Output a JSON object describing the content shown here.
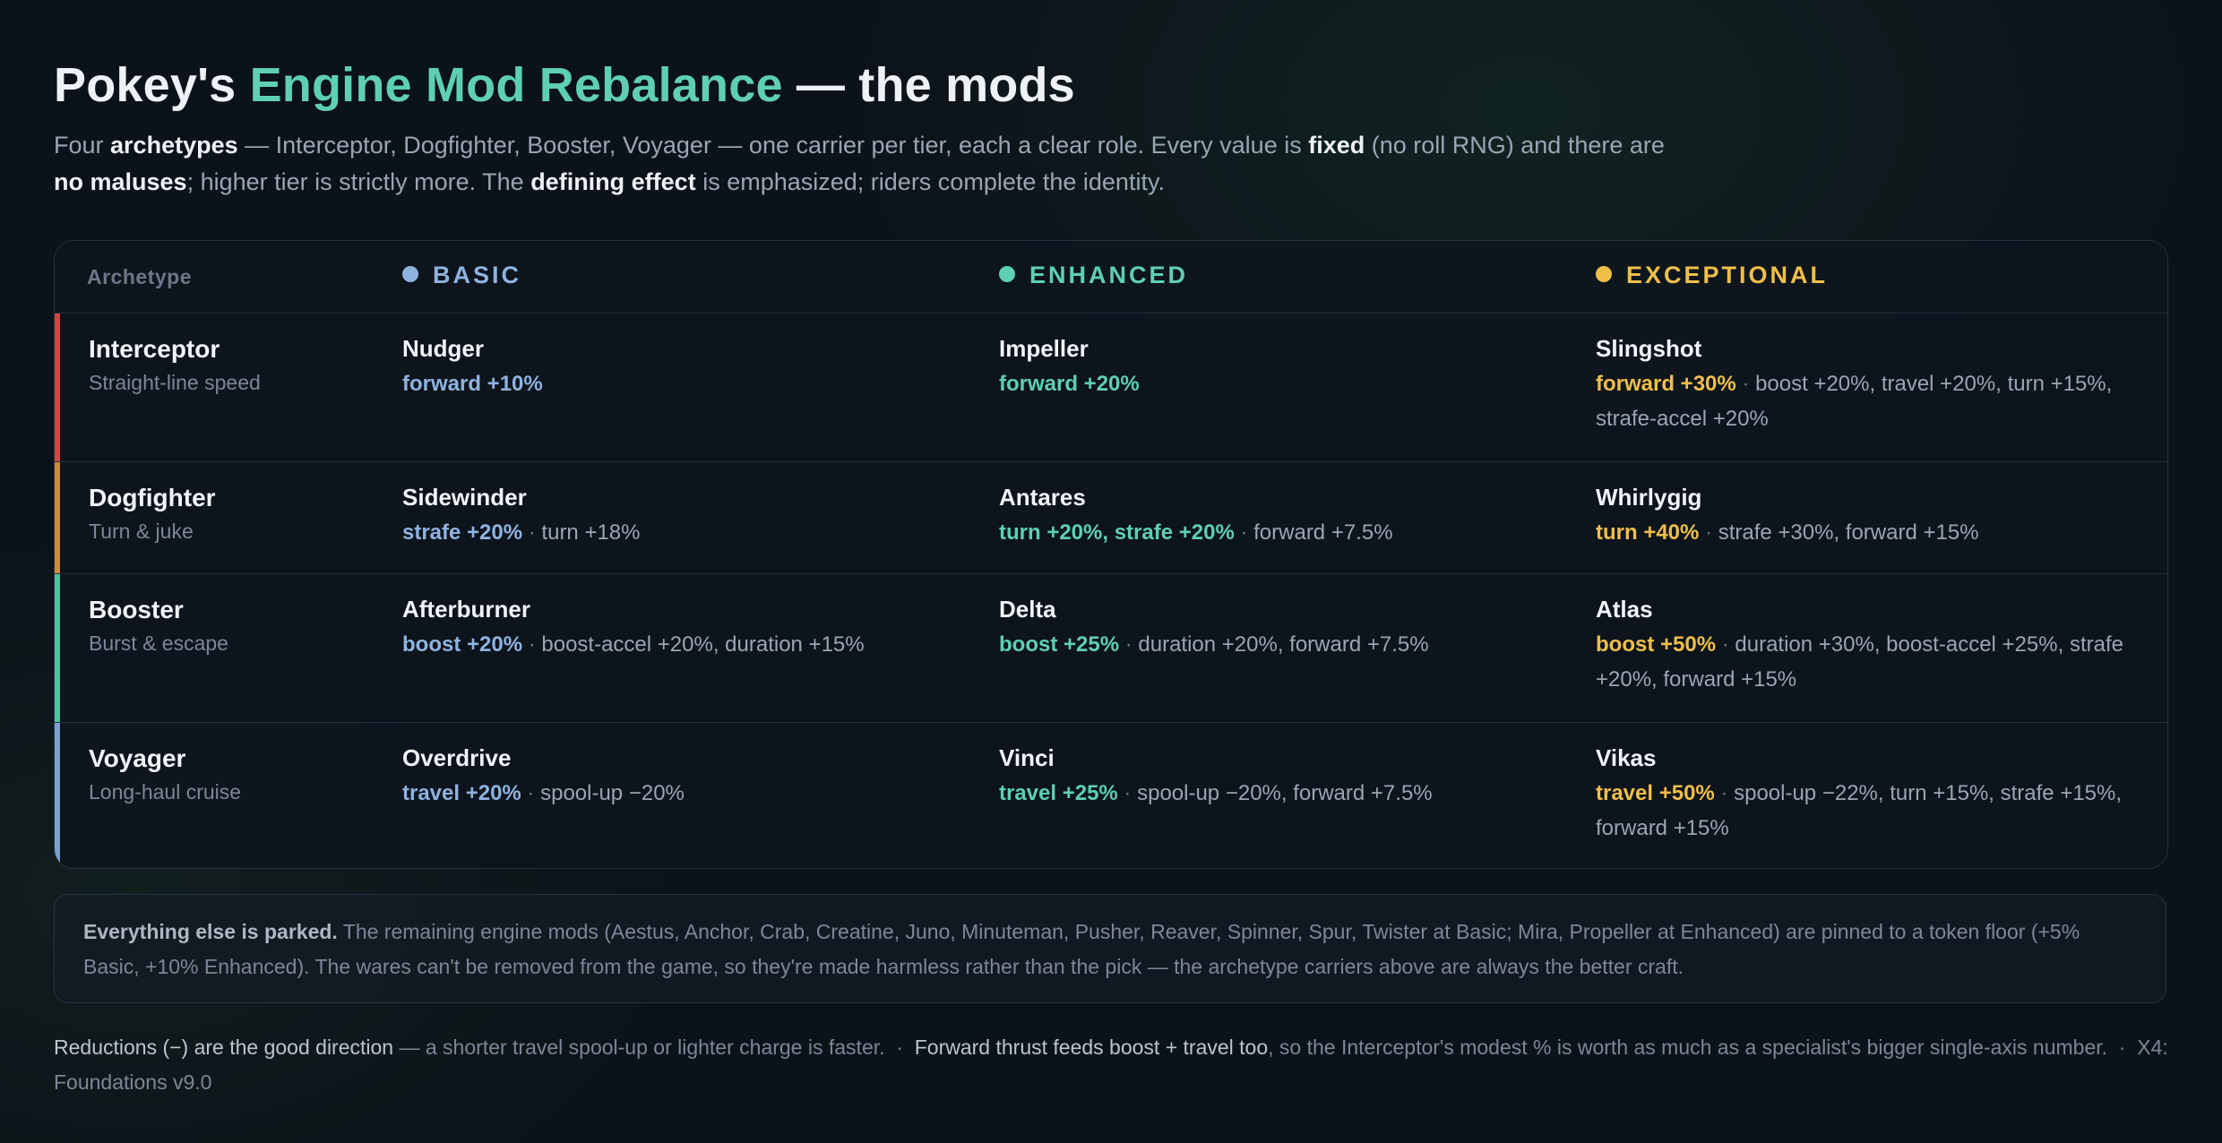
{
  "title": {
    "part1": "Pokey's ",
    "accent": "Engine Mod Rebalance",
    "part2": " — the mods"
  },
  "intro": {
    "t1": "Four ",
    "b1": "archetypes",
    "t2": " — Interceptor, Dogfighter, Booster, Voyager — one carrier per tier, each a clear role. Every value is ",
    "b2": "fixed",
    "t3": " (no roll RNG) and there are ",
    "b3": "no maluses",
    "t4": "; higher tier is strictly more. The ",
    "b4": "defining effect",
    "t5": " is emphasized; riders complete the identity."
  },
  "colors": {
    "basic": "#8fb3e0",
    "enhanced": "#5fcfb3",
    "exceptional": "#f0bf4a",
    "interceptor": "#d0483f",
    "dogfighter": "#cf8a3a",
    "booster": "#4fc4a0",
    "voyager": "#7f9fd0"
  },
  "table": {
    "header": {
      "archetype": "Archetype",
      "basic": "BASIC",
      "enhanced": "ENHANCED",
      "exceptional": "EXCEPTIONAL"
    },
    "rows": [
      {
        "name": "Interceptor",
        "desc": "Straight-line speed",
        "basic": {
          "mod": "Nudger",
          "effect": "forward +10%",
          "riders": ""
        },
        "enhanced": {
          "mod": "Impeller",
          "effect": "forward +20%",
          "riders": ""
        },
        "exceptional": {
          "mod": "Slingshot",
          "effect": "forward +30%",
          "riders": "boost +20%, travel +20%, turn +15%, strafe-accel +20%"
        }
      },
      {
        "name": "Dogfighter",
        "desc": "Turn & juke",
        "basic": {
          "mod": "Sidewinder",
          "effect": "strafe +20%",
          "riders": "turn +18%"
        },
        "enhanced": {
          "mod": "Antares",
          "effect": "turn +20%, strafe +20%",
          "riders": "forward +7.5%"
        },
        "exceptional": {
          "mod": "Whirlygig",
          "effect": "turn +40%",
          "riders": "strafe +30%, forward +15%"
        }
      },
      {
        "name": "Booster",
        "desc": "Burst & escape",
        "basic": {
          "mod": "Afterburner",
          "effect": "boost +20%",
          "riders": "boost-accel +20%, duration +15%"
        },
        "enhanced": {
          "mod": "Delta",
          "effect": "boost +25%",
          "riders": "duration +20%, forward +7.5%"
        },
        "exceptional": {
          "mod": "Atlas",
          "effect": "boost +50%",
          "riders": "duration +30%, boost-accel +25%, strafe +20%, forward +15%"
        }
      },
      {
        "name": "Voyager",
        "desc": "Long-haul cruise",
        "basic": {
          "mod": "Overdrive",
          "effect": "travel +20%",
          "riders": "spool-up −20%"
        },
        "enhanced": {
          "mod": "Vinci",
          "effect": "travel +25%",
          "riders": "spool-up −20%, forward +7.5%"
        },
        "exceptional": {
          "mod": "Vikas",
          "effect": "travel +50%",
          "riders": "spool-up −22%, turn +15%, strafe +15%, forward +15%"
        }
      }
    ]
  },
  "separator": " · ",
  "note": {
    "bold": "Everything else is parked.",
    "text": " The remaining engine mods (Aestus, Anchor, Crab, Creatine, Juno, Minuteman, Pusher, Reaver, Spinner, Spur, Twister at Basic; Mira, Propeller at Enhanced) are pinned to a token floor (+5% Basic, +10% Enhanced). The wares can't be removed from the game, so they're made harmless rather than the pick — the archetype carriers above are always the better craft."
  },
  "footer": {
    "hl1": "Reductions (−) are the good direction",
    "t1": " — a shorter travel spool-up or lighter charge is faster.",
    "dot": "  ·  ",
    "hl2": "Forward thrust feeds boost + travel too",
    "t2": ", so the Interceptor's modest % is worth as much as a specialist's bigger single-axis number.",
    "version": "X4: Foundations v9.0"
  }
}
